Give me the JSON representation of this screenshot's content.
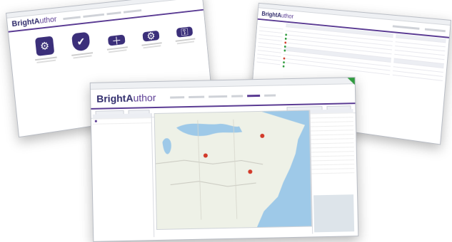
{
  "left_window": {
    "logo_main": "BrightA",
    "logo_accent": "uthor",
    "tiles": [
      {
        "icon": "gear-cluster-icon",
        "glyph": "⚙"
      },
      {
        "icon": "shield-check-icon",
        "glyph": "✔"
      },
      {
        "icon": "laptop-add-icon",
        "glyph": "＋"
      },
      {
        "icon": "laptop-settings-icon",
        "glyph": "⚙"
      },
      {
        "icon": "laptop-lock-icon",
        "glyph": "⚿"
      }
    ]
  },
  "right_window": {
    "logo_main": "BrightA",
    "logo_accent": "uthor"
  },
  "main_window": {
    "logo_main": "BrightA",
    "logo_accent": "uthor",
    "map": {
      "city_pins": [
        {
          "name": "pin-1"
        },
        {
          "name": "pin-2"
        },
        {
          "name": "pin-3"
        }
      ]
    }
  },
  "colors": {
    "brand": "#2f2b6b",
    "accent": "#5a3b93",
    "map_land": "#eef1e7",
    "map_water": "#9ec9e8",
    "pin": "#d23a2a",
    "flag": "#2e9b3d"
  }
}
